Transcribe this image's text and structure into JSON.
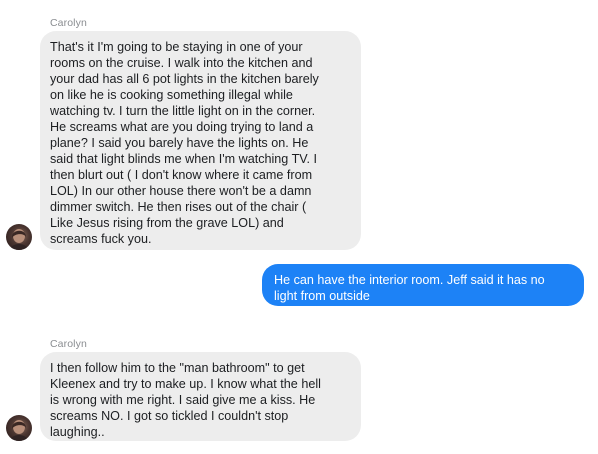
{
  "conversation": {
    "messages": [
      {
        "direction": "incoming",
        "sender": "Carolyn",
        "text": "That's it I'm going to be staying in one of your\nrooms on the cruise.   I walk into the kitchen and\nyour dad has all 6 pot lights in the kitchen barely\non like he is cooking something illegal while\nwatching tv.  I turn the little light on in the corner.\nHe screams what are you doing trying to land a\nplane?  I said you barely have the lights on.  He\nsaid that light blinds me when I'm watching TV.  I\nthen blurt out ( I don't know where it came from\nLOL)  In our other house there won't be a damn\ndimmer switch.  He then rises out of the chair (\nLike Jesus rising from the grave LOL)  and\nscreams fuck you."
      },
      {
        "direction": "outgoing",
        "text": "He can have the interior room. Jeff said it has no\nlight from outside"
      },
      {
        "direction": "incoming",
        "sender": "Carolyn",
        "text": "I then follow him to the \"man bathroom\" to get\nKleenex and try to make up.  I know what the hell\nis wrong with me right.  I said give me a kiss.  He\nscreams NO.  I got so tickled I couldn't stop\nlaughing.."
      }
    ]
  },
  "colors": {
    "incoming_bubble": "#ededed",
    "outgoing_bubble": "#1d82f6",
    "sender_name": "#8a8d91"
  },
  "icons": {
    "avatar": "carolyn-avatar"
  }
}
